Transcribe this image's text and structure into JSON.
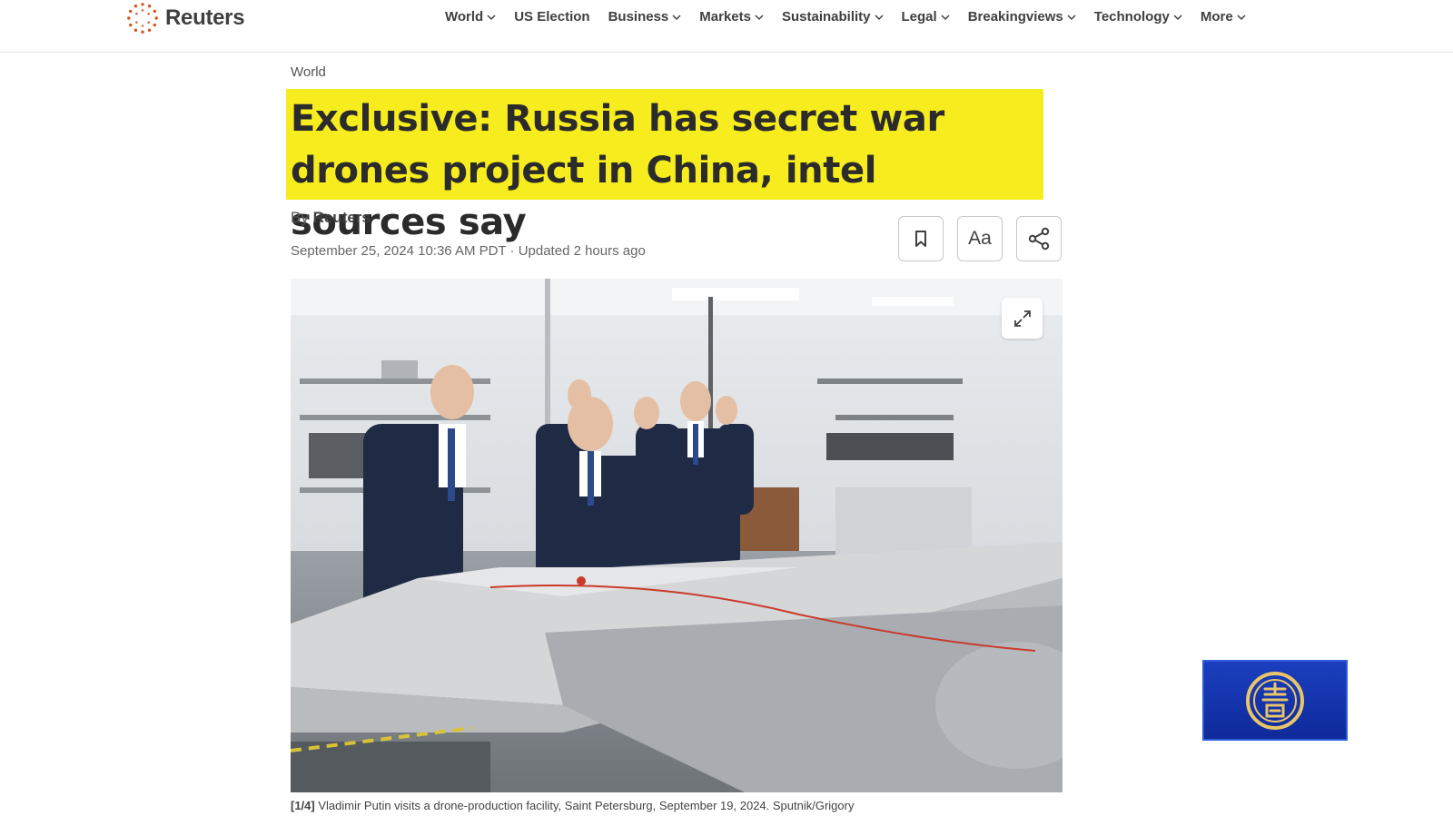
{
  "site": {
    "name": "Reuters"
  },
  "nav": [
    {
      "label": "World",
      "dropdown": true
    },
    {
      "label": "US Election",
      "dropdown": false
    },
    {
      "label": "Business",
      "dropdown": true
    },
    {
      "label": "Markets",
      "dropdown": true
    },
    {
      "label": "Sustainability",
      "dropdown": true
    },
    {
      "label": "Legal",
      "dropdown": true
    },
    {
      "label": "Breakingviews",
      "dropdown": true
    },
    {
      "label": "Technology",
      "dropdown": true
    },
    {
      "label": "More",
      "dropdown": true
    }
  ],
  "article": {
    "section": "World",
    "headline": "Exclusive: Russia has secret war drones project in China, intel sources say",
    "byline_prefix": "By",
    "author": "Reuters",
    "dateline": "September 25, 2024 10:36 AM PDT · Updated 2 hours ago",
    "font_button_label": "Aa",
    "caption_index": "[1/4]",
    "caption_text": "Vladimir Putin visits a drone-production facility, Saint Petersburg, September 19, 2024. Sputnik/Grigory"
  },
  "colors": {
    "highlight": "#f7ed1e",
    "accent": "#d9531e",
    "channel_blue": "#1a3fbf"
  }
}
